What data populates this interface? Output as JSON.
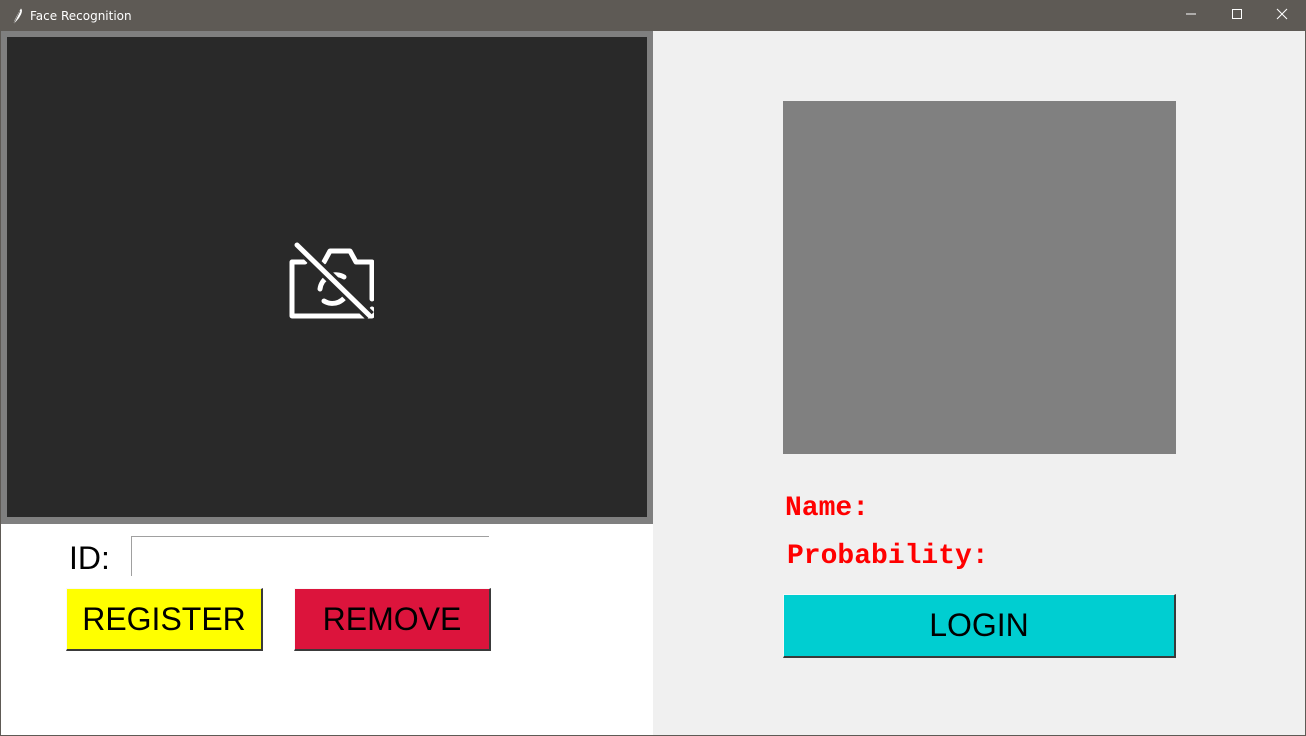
{
  "window": {
    "title": "Face Recognition",
    "titlebar_color": "#5e5a55",
    "controls": [
      "minimize-icon",
      "maximize-icon",
      "close-icon"
    ]
  },
  "left_panel": {
    "video_feed": {
      "status_icon": "camera-off-icon",
      "frame_color": "#7f7f7f",
      "background_color": "#292929"
    },
    "id_label": "ID:",
    "id_input": {
      "value": "",
      "placeholder": ""
    },
    "register_button": {
      "label": "REGISTER",
      "color": "#ffff00"
    },
    "remove_button": {
      "label": "REMOVE",
      "color": "#dc143c"
    }
  },
  "right_panel": {
    "background_color": "#f0f0f0",
    "photo_placeholder_color": "#808080",
    "name_label": "Name:",
    "probability_label": "Probability:",
    "text_color": "#ff0000",
    "login_button": {
      "label": "LOGIN",
      "color": "#00ced1"
    }
  }
}
